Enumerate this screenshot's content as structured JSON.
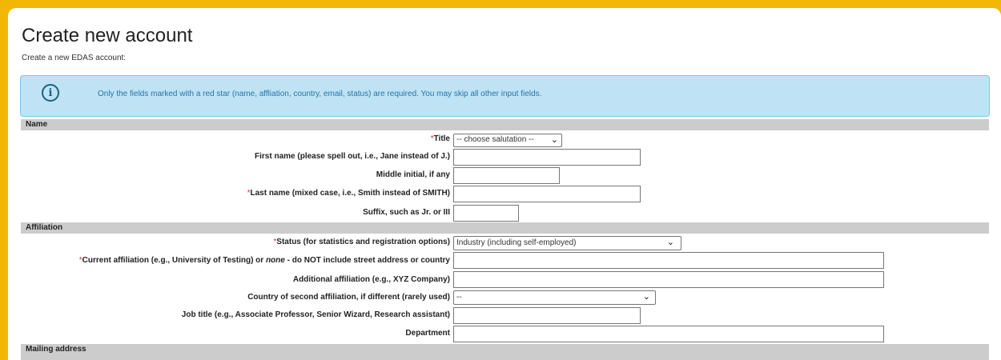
{
  "page": {
    "title": "Create new account",
    "subtitle": "Create a new EDAS account:"
  },
  "notice": {
    "icon": "info-icon",
    "text": "Only the fields marked with a red star (name, affliation, country, email, status) are required. You may skip all other input fields."
  },
  "sections": {
    "name": "Name",
    "affiliation": "Affiliation",
    "mailing": "Mailing address"
  },
  "fields": {
    "title": {
      "required": "*",
      "label": "Title",
      "value": "-- choose salutation --"
    },
    "first_name": {
      "label": "First name (please spell out, i.e., Jane instead of J.)",
      "value": ""
    },
    "middle_initial": {
      "label": "Middle initial, if any",
      "value": ""
    },
    "last_name": {
      "required": "*",
      "label": "Last name (mixed case, i.e., Smith instead of SMITH)",
      "value": ""
    },
    "suffix": {
      "label": "Suffix, such as Jr. or III",
      "value": ""
    },
    "status": {
      "required": "*",
      "label": "Status (for statistics and registration options)",
      "value": "Industry (including self-employed)"
    },
    "current_affiliation": {
      "required": "*",
      "label_part1": "Current affiliation (e.g., University of Testing) or ",
      "label_italic": "none",
      "label_part2": " - do NOT include street address or country",
      "value": ""
    },
    "additional_affiliation": {
      "label": "Additional affiliation (e.g., XYZ Company)",
      "value": ""
    },
    "second_country": {
      "label": "Country of second affiliation, if different (rarely used)",
      "value": "--"
    },
    "job_title": {
      "label": "Job title (e.g., Associate Professor, Senior Wizard, Research assistant)",
      "value": ""
    },
    "department": {
      "label": "Department",
      "value": ""
    }
  },
  "colors": {
    "frame": "#f2b705",
    "notice_bg": "#bfe3f4",
    "notice_text": "#2574a9",
    "section_bg": "#cccccc",
    "required_star": "#e03030"
  }
}
